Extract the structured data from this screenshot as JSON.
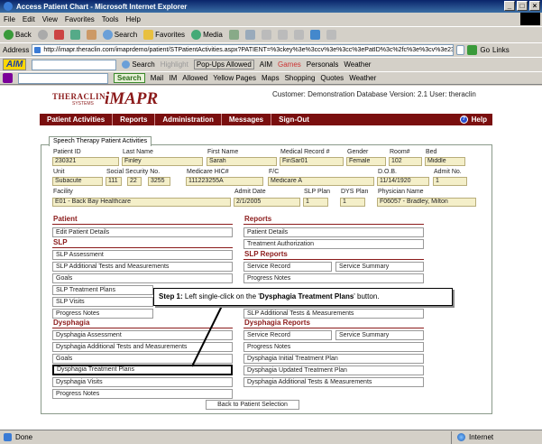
{
  "window": {
    "title": "Access Patient Chart - Microsoft Internet Explorer",
    "controls": [
      "_",
      "□",
      "×"
    ]
  },
  "menu": [
    "File",
    "Edit",
    "View",
    "Favorites",
    "Tools",
    "Help"
  ],
  "toolbar": {
    "back": "Back",
    "search": "Search",
    "favorites": "Favorites",
    "media": "Media"
  },
  "address": {
    "label": "Address",
    "url": "http://imapr.theraclin.com/imaprdemo/patient/STPatientActivities.aspx?PATIENT=%3ckey%3e%3ccv%3e%3cc%3ePatID%3c%2fc%3e%3cv%3e2303:",
    "go": "Go",
    "links": "Links"
  },
  "aim": {
    "logo": "AIM",
    "search": "Search",
    "highlight": "Highlight",
    "popups": "Pop-Ups Allowed",
    "aim": "AIM",
    "games": "Games",
    "personals": "Personals",
    "weather": "Weather"
  },
  "yahoo": {
    "search": "Search",
    "mail": "Mail",
    "im": "IM",
    "allowed": "Allowed",
    "yellow_pages": "Yellow Pages",
    "maps": "Maps",
    "shopping": "Shopping",
    "quotes": "Quotes",
    "weather": "Weather"
  },
  "app": {
    "logo_thera": "THERACLIN",
    "logo_systems": "SYSTEMS",
    "logo_imapr": "iMAPR",
    "customer_line": "Customer: Demonstration Database Version: 2.1 User: theraclin",
    "nav": [
      "Patient Activities",
      "Reports",
      "Administration",
      "Messages",
      "Sign-Out"
    ],
    "help": "Help",
    "help_icon": "?",
    "tab": "Speech Therapy Patient Activities"
  },
  "patient": {
    "labels": {
      "patient_id": "Patient ID",
      "last_name": "Last Name",
      "first_name": "First Name",
      "mrn": "Medical Record #",
      "gender": "Gender",
      "room": "Room#",
      "bed": "Bed",
      "unit": "Unit",
      "ssn": "Social Security No.",
      "medicare_hic": "Medicare HIC#",
      "fc": "F/C",
      "dob": "D.O.B.",
      "admit_no": "Admit No.",
      "facility": "Facility",
      "admit_date": "Admit Date",
      "slp_plan": "SLP Plan",
      "dys_plan": "DYS Plan",
      "physician": "Physician Name"
    },
    "values": {
      "patient_id": "230321",
      "last_name": "Finley",
      "first_name": "Sarah",
      "mrn": "FinSar01",
      "gender": "Female",
      "room": "102",
      "bed": "Middle",
      "unit": "Subacute",
      "ssn1": "111",
      "ssn2": "22",
      "ssn3": "3255",
      "medicare_hic": "111223255A",
      "fc": "Medicare A",
      "dob": "11/14/1920",
      "admit_no": "1",
      "facility": "E01 - Back Bay Healthcare",
      "admit_date": "2/1/2005",
      "slp_plan": "1",
      "dys_plan": "1",
      "physician": "F06057 - Bradley, Milton"
    }
  },
  "sections": {
    "patient": "Patient",
    "slp": "SLP",
    "dysphagia": "Dysphagia",
    "reports": "Reports",
    "slp_reports": "SLP Reports",
    "dysphagia_reports": "Dysphagia Reports"
  },
  "buttons": {
    "edit_patient_details": "Edit Patient Details",
    "slp_assessment": "SLP Assessment",
    "slp_additional": "SLP Additional Tests and Measurements",
    "slp_goals": "Goals",
    "slp_treatment_plans": "SLP Treatment Plans",
    "slp_visits": "SLP Visits",
    "slp_progress_notes": "Progress Notes",
    "dys_assessment": "Dysphagia Assessment",
    "dys_additional": "Dysphagia Additional Tests and Measurements",
    "dys_goals": "Goals",
    "dys_treatment_plans": "Dysphagia Treatment Plans",
    "dys_visits": "Dysphagia Visits",
    "dys_progress_notes": "Progress Notes",
    "patient_details": "Patient Details",
    "treatment_authorization": "Treatment Authorization",
    "slp_service_record": "Service Record",
    "slp_service_summary": "Service Summary",
    "slp_rpt_progress_notes": "Progress Notes",
    "slp_rpt_additional": "SLP Additional Tests & Measurements",
    "dys_service_record": "Service Record",
    "dys_service_summary": "Service Summary",
    "dys_rpt_progress_notes": "Progress Notes",
    "dys_initial_plan": "Dysphagia Initial Treatment Plan",
    "dys_updated_plan": "Dysphagia Updated Treatment Plan",
    "dys_rpt_additional": "Dysphagia Additional Tests & Measurements",
    "back_to_selection": "Back to Patient Selection"
  },
  "callout": {
    "step": "Step 1:",
    "text_before": " Left single-click on the '",
    "target": "Dysphagia Treatment Plans",
    "text_after": "' button."
  },
  "status": {
    "done": "Done",
    "zone": "Internet"
  }
}
